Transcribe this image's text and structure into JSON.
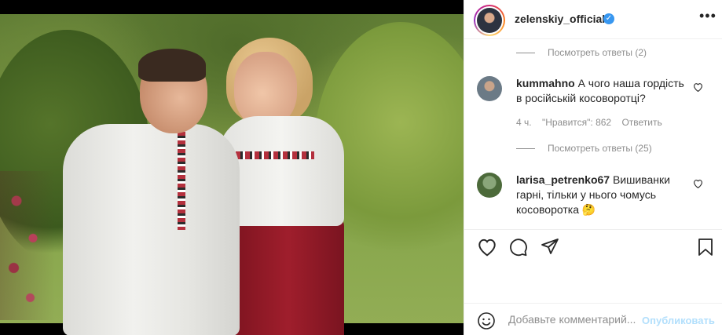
{
  "post": {
    "username": "zelenskiy_official",
    "verified_mark": "✓",
    "more_label": "•••"
  },
  "thread": {
    "view_replies_1": "Посмотреть ответы (2)",
    "comment1": {
      "user": "kummahno",
      "text": "А чого наша гордість в російській косоворотці?",
      "time": "4 ч.",
      "likes": "\"Нравится\": 862",
      "reply": "Ответить"
    },
    "view_replies_2": "Посмотреть ответы (25)",
    "comment2": {
      "user": "larisa_petrenko67",
      "text": "Вишиванки гарні, тільки у нього чомусь косоворотка 🤔"
    }
  },
  "composer": {
    "placeholder": "Добавьте комментарий...",
    "publish_label": "Опубликовать"
  },
  "icons": {
    "like": "heart-icon",
    "comment": "comment-icon",
    "share": "paper-plane-icon",
    "save": "bookmark-icon",
    "emoji": "smiley-icon"
  },
  "colors": {
    "accent": "#3897f0",
    "publish_disabled": "#b2dffc",
    "muted_text": "#8e8e8e"
  }
}
